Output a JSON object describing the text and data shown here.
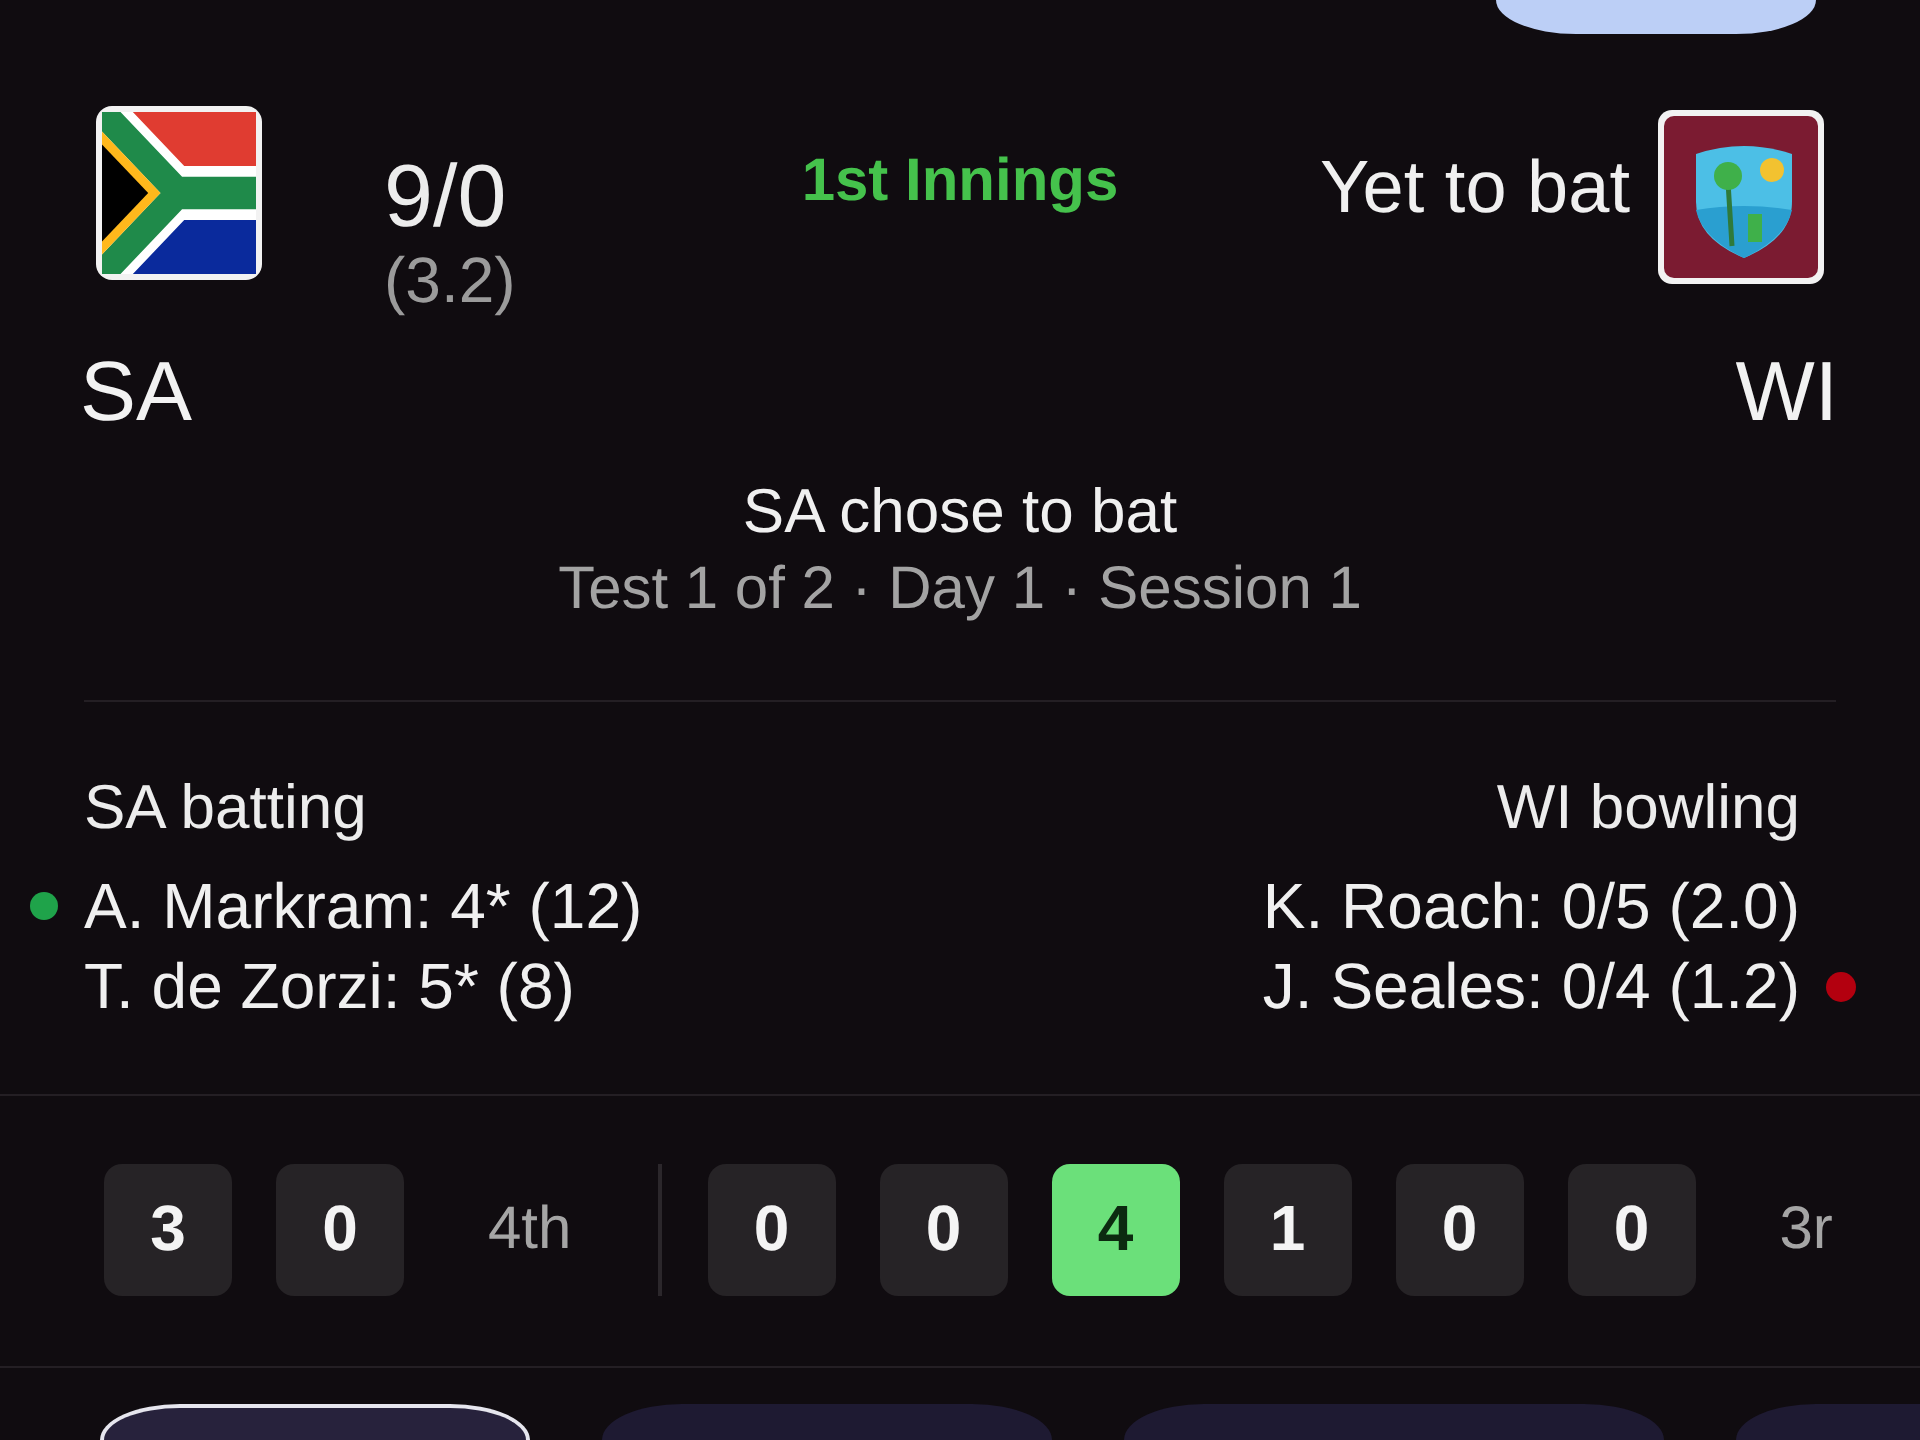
{
  "scoreboard": {
    "home": {
      "emblem": {
        "kind": "flag"
      },
      "score": "9/0",
      "overs": "(3.2)",
      "abbr": "SA"
    },
    "innings_label": "1st Innings",
    "away": {
      "emblem": {
        "kind": "crest"
      },
      "status": "Yet to bat",
      "abbr": "WI"
    }
  },
  "toss": "SA chose to bat",
  "match_info": "Test 1 of 2 · Day 1 · Session 1",
  "batting": {
    "title": "SA batting",
    "players": [
      {
        "line": "A. Markram: 4* (12)",
        "active": true
      },
      {
        "line": "T. de Zorzi: 5* (8)",
        "active": false
      }
    ]
  },
  "bowling": {
    "title": "WI bowling",
    "players": [
      {
        "line": "K. Roach: 0/5 (2.0)",
        "active": false
      },
      {
        "line": "J. Seales: 0/4 (1.2)",
        "active": true
      }
    ]
  },
  "overs": [
    {
      "balls": [
        {
          "runs": "3",
          "kind": "run"
        },
        {
          "runs": "0",
          "kind": "run"
        }
      ],
      "label": "4th"
    },
    {
      "balls": [
        {
          "runs": "0",
          "kind": "run"
        },
        {
          "runs": "0",
          "kind": "run"
        },
        {
          "runs": "4",
          "kind": "four"
        },
        {
          "runs": "1",
          "kind": "run"
        },
        {
          "runs": "0",
          "kind": "run"
        },
        {
          "runs": "0",
          "kind": "run"
        }
      ],
      "label": "3r"
    }
  ],
  "chips": [
    {
      "selected": true
    },
    {
      "selected": false
    },
    {
      "selected": false
    },
    {
      "selected": false
    }
  ]
}
